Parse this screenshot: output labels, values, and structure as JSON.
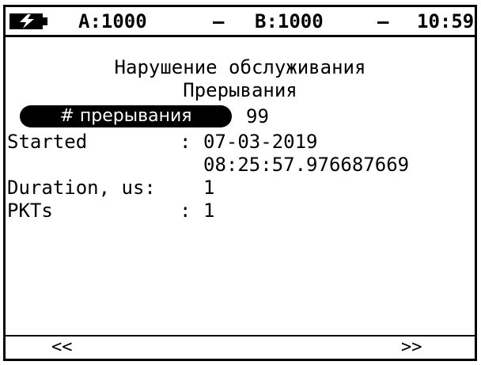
{
  "status": {
    "battery_icon": "battery-charging-icon",
    "a_label": "A:1000",
    "sep1": "–",
    "b_label": "B:1000",
    "sep2": "–",
    "time": "10:59"
  },
  "main": {
    "title_line1": "Нарушение обслуживания",
    "title_line2": "Прерывания",
    "interruptions_button_label": "# прерывания",
    "interruptions_value": "99",
    "fields": {
      "started_label": "Started",
      "started_colon": ":",
      "started_date": "07-03-2019",
      "started_time": "08:25:57.976687669",
      "duration_label": "Duration, us:",
      "duration_value": "1",
      "pkts_label": "PKTs",
      "pkts_colon": ":",
      "pkts_value": "1"
    }
  },
  "softkeys": {
    "prev": "<<",
    "next": ">>"
  }
}
